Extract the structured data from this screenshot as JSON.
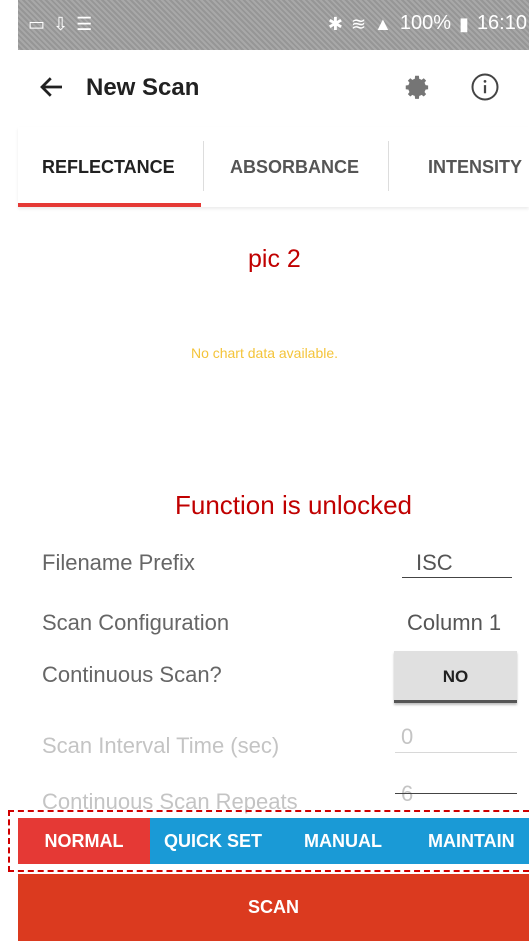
{
  "status_bar": {
    "battery_text": "100%",
    "time": "16:10"
  },
  "app_bar": {
    "title": "New Scan"
  },
  "tabs": [
    "REFLECTANCE",
    "ABSORBANCE",
    "INTENSITY"
  ],
  "overlay_labels": {
    "pic": "pic 2",
    "unlocked": "Function is unlocked"
  },
  "chart": {
    "empty_message": "No chart data available."
  },
  "settings": {
    "filename_prefix": {
      "label": "Filename Prefix",
      "value": "ISC"
    },
    "scan_configuration": {
      "label": "Scan Configuration",
      "value": "Column 1"
    },
    "continuous_scan": {
      "label": "Continuous Scan?",
      "value": "NO"
    },
    "scan_interval": {
      "label": "Scan Interval Time (sec)",
      "value": "0"
    },
    "continuous_repeats": {
      "label": "Continuous Scan Repeats",
      "value": "6"
    }
  },
  "modes": [
    "NORMAL",
    "QUICK SET",
    "MANUAL",
    "MAINTAIN"
  ],
  "scan_button": "SCAN",
  "colors": {
    "accent": "#e53935",
    "mode_bar": "#1a9ad6",
    "scan_button": "#db3a1f",
    "annotation": "#c00000",
    "empty_message": "#f4c43a"
  }
}
